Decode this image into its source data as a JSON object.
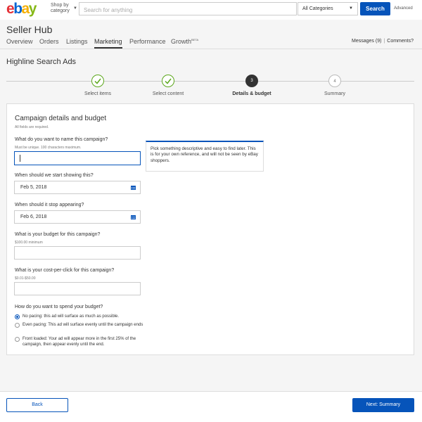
{
  "header": {
    "logo": {
      "l1": "e",
      "l2": "b",
      "l3": "a",
      "l4": "y"
    },
    "shop_by": "Shop by category",
    "search_placeholder": "Search for anything",
    "category": "All Categories",
    "search_button": "Search",
    "advanced": "Advanced"
  },
  "hub": {
    "title": "Seller Hub",
    "nav": [
      "Overview",
      "Orders",
      "Listings",
      "Marketing",
      "Performance",
      "Growth"
    ],
    "growth_badge": "BETA",
    "active_tab": "Marketing",
    "messages": "Messages (9)",
    "comments": "Comments?"
  },
  "page": {
    "title": "Highline Search Ads"
  },
  "stepper": {
    "steps": [
      {
        "label": "Select items",
        "state": "done",
        "number": "1"
      },
      {
        "label": "Select content",
        "state": "done",
        "number": "2"
      },
      {
        "label": "Details & budget",
        "state": "current",
        "number": "3"
      },
      {
        "label": "Summary",
        "state": "todo",
        "number": "4"
      }
    ]
  },
  "form": {
    "title": "Campaign details and budget",
    "subtitle": "All fields are required.",
    "name_q": "What do you want to name this campaign?",
    "name_hint": "Must be unique. 100 characters maximum.",
    "name_value": "",
    "tooltip": "Pick something descriptive and easy to find later. This is for your own reference, and will not be seen by eBay shoppers.",
    "start_q": "When should we start showing this?",
    "start_value": "Feb 5, 2018",
    "stop_q": "When should it stop appearing?",
    "stop_value": "Feb 6, 2018",
    "budget_q": "What is your budget for this campaign?",
    "budget_hint": "$100.00 minimum",
    "budget_value": "",
    "cpc_q": "What is your cost-per-click for this campaign?",
    "cpc_hint": "$0.01-$50.00",
    "cpc_value": "",
    "spend_q": "How do you want to spend your budget?",
    "spend_options": [
      {
        "label": "No pacing: this ad will surface as much as possible.",
        "checked": true
      },
      {
        "label": "Even pacing: This ad will surface evenly until the campaign ends",
        "checked": false
      },
      {
        "label": "Front loaded: Your ad will appear more in the first 25% of the campaign, then appear evenly until the end.",
        "checked": false
      }
    ]
  },
  "footer": {
    "back": "Back",
    "next": "Next: Summary"
  },
  "colors": {
    "primary": "#0654ba",
    "success": "#5ba71b"
  }
}
